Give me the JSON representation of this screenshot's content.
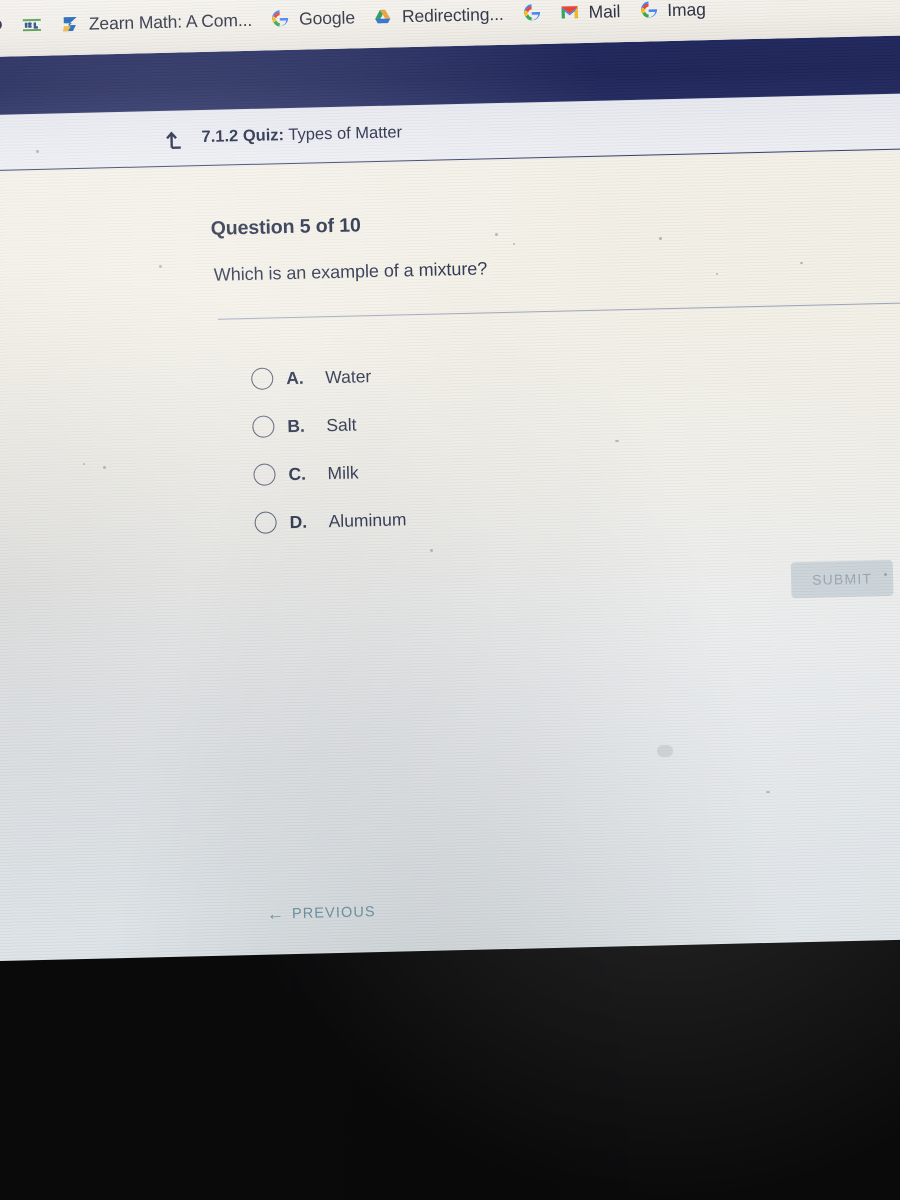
{
  "browser": {
    "bookmarks": [
      {
        "label": "",
        "icon": "speech-bubble-icon"
      },
      {
        "label": "",
        "icon": "ixl-icon"
      },
      {
        "label": "Zearn Math: A Com...",
        "icon": "zearn-icon"
      },
      {
        "label": "Google",
        "icon": "google-g-icon"
      },
      {
        "label": "Redirecting...",
        "icon": "google-drive-icon"
      },
      {
        "label": "",
        "icon": "google-g-icon"
      },
      {
        "label": "Mail",
        "icon": "gmail-icon"
      },
      {
        "label": "Imag",
        "icon": "google-g-icon"
      }
    ]
  },
  "header": {
    "back_icon": "return-arrow-icon",
    "lesson_number": "7.1.2",
    "activity_label": "Quiz:",
    "activity_name": "Types of Matter"
  },
  "quiz": {
    "progress": "Question 5 of 10",
    "question": "Which is an example of a mixture?",
    "choices": [
      {
        "letter": "A.",
        "text": "Water",
        "selected": false
      },
      {
        "letter": "B.",
        "text": "Salt",
        "selected": false
      },
      {
        "letter": "C.",
        "text": "Milk",
        "selected": false
      },
      {
        "letter": "D.",
        "text": "Aluminum",
        "selected": false
      }
    ],
    "submit_label": "SUBMIT",
    "previous_label": "PREVIOUS",
    "previous_arrow": "←"
  },
  "colors": {
    "chrome_band": "#20275c",
    "header_border": "#323a6b",
    "text": "#1c2540",
    "submit_bg": "#c6cfd6",
    "submit_text": "#8d9aa5",
    "previous_text": "#4b7f92",
    "page_bg": "#f3f0e7"
  }
}
